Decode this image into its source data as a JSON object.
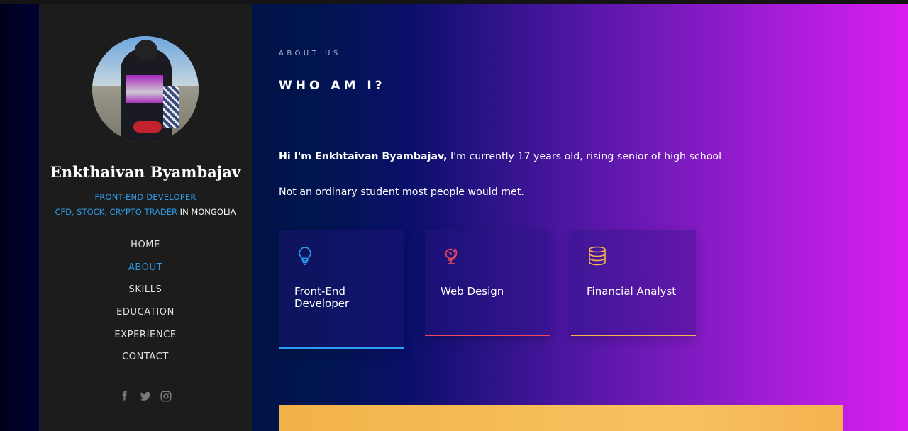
{
  "sidebar": {
    "name": "Enkthaivan Byambajav",
    "role_line1": "FRONT-END DEVELOPER",
    "role_line2_colored": "CFD, STOCK, CRYPTO TRADER",
    "role_line2_white": " IN MONGOLIA",
    "nav": [
      {
        "label": "HOME",
        "active": false
      },
      {
        "label": "ABOUT",
        "active": true
      },
      {
        "label": "SKILLS",
        "active": false
      },
      {
        "label": "EDUCATION",
        "active": false
      },
      {
        "label": "EXPERIENCE",
        "active": false
      },
      {
        "label": "CONTACT",
        "active": false
      }
    ],
    "socials": [
      "facebook-icon",
      "twitter-icon",
      "instagram-icon"
    ]
  },
  "content": {
    "eyebrow": "ABOUT US",
    "heading": "WHO AM I?",
    "intro_bold": "Hi I'm Enkhtaivan Byambajav,",
    "intro_rest": " I'm currently 17 years old, rising senior of high school",
    "intro2": "Not an ordinary student most people would met.",
    "cards": [
      {
        "title": "Front-End Developer",
        "icon": "lightbulb-icon",
        "accent": "#2b9ff5"
      },
      {
        "title": "Web Design",
        "icon": "globe-icon",
        "accent": "#f0485c"
      },
      {
        "title": "Financial Analyst",
        "icon": "database-icon",
        "accent": "#f7b34d"
      }
    ]
  },
  "colors": {
    "sidebar_bg": "#1c1c1c",
    "accent_blue": "#2f9be8",
    "banner": "#f8c260"
  }
}
